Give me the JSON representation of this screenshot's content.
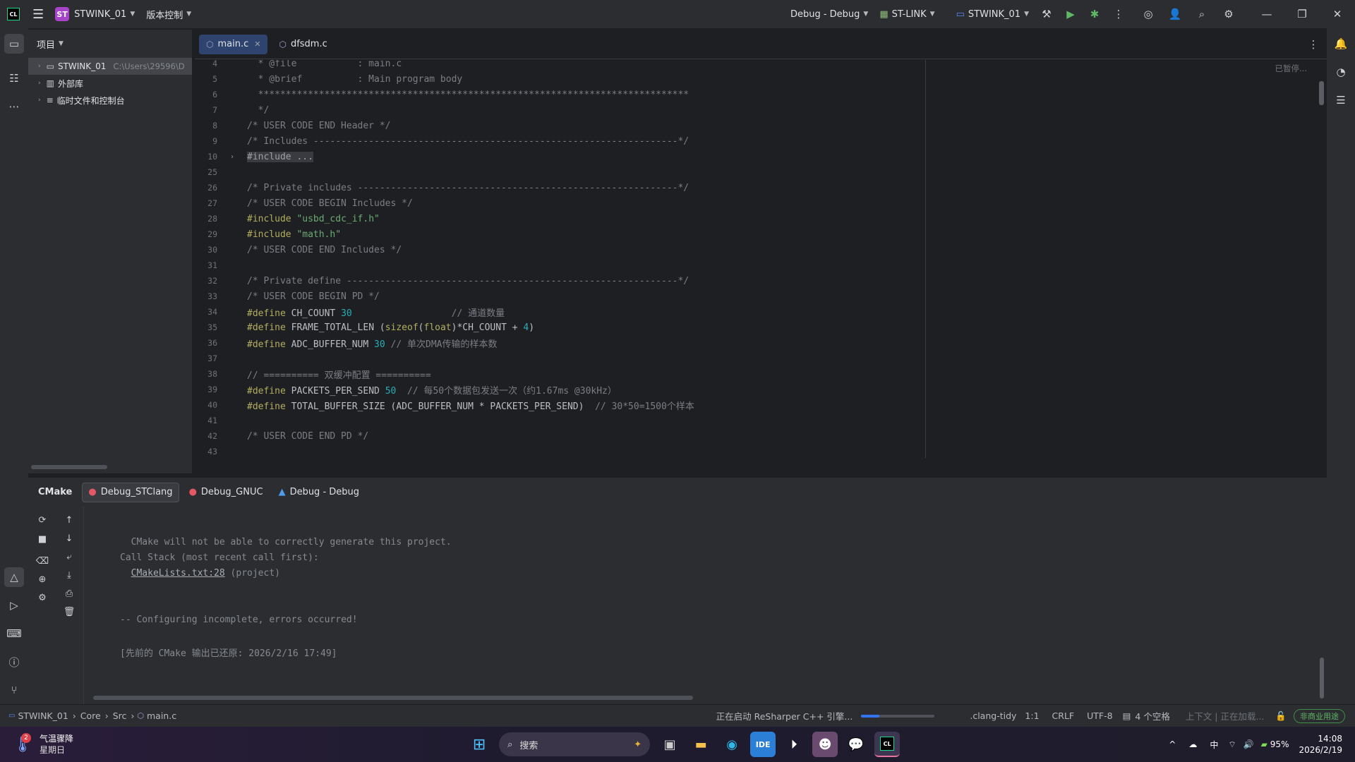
{
  "topbar": {
    "project_badge": "ST",
    "project_name": "STWINK_01",
    "vcs_label": "版本控制",
    "run_config": "Debug - Debug",
    "debugger": "ST-LINK",
    "target": "STWINK_01"
  },
  "project_panel": {
    "title": "项目",
    "items": [
      {
        "label": "STWINK_01",
        "path": "C:\\Users\\29596\\D"
      },
      {
        "label": "外部库",
        "path": ""
      },
      {
        "label": "临时文件和控制台",
        "path": ""
      }
    ]
  },
  "editor": {
    "tabs": [
      {
        "label": "main.c",
        "active": true
      },
      {
        "label": "dfsdm.c",
        "active": false
      }
    ],
    "paused_hint": "已暂停...",
    "lines": [
      {
        "n": "4",
        "text": "  * @file           : main.c"
      },
      {
        "n": "5",
        "text": "  * @brief          : Main program body"
      },
      {
        "n": "6",
        "text": "  ******************************************************************************"
      },
      {
        "n": "7",
        "text": "  */"
      },
      {
        "n": "8",
        "text": "/* USER CODE END Header */"
      },
      {
        "n": "9",
        "text": "/* Includes ------------------------------------------------------------------*/"
      },
      {
        "n": "10",
        "text": "#include ..."
      },
      {
        "n": "25",
        "text": ""
      },
      {
        "n": "26",
        "text": "/* Private includes ----------------------------------------------------------*/"
      },
      {
        "n": "27",
        "text": "/* USER CODE BEGIN Includes */"
      },
      {
        "n": "28",
        "text": "#include \"usbd_cdc_if.h\""
      },
      {
        "n": "29",
        "text": "#include \"math.h\""
      },
      {
        "n": "30",
        "text": "/* USER CODE END Includes */"
      },
      {
        "n": "31",
        "text": ""
      },
      {
        "n": "32",
        "text": "/* Private define ------------------------------------------------------------*/"
      },
      {
        "n": "33",
        "text": "/* USER CODE BEGIN PD */"
      },
      {
        "n": "34",
        "text": "#define CH_COUNT 30                  // 通道数量"
      },
      {
        "n": "35",
        "text": "#define FRAME_TOTAL_LEN (sizeof(float)*CH_COUNT + 4)"
      },
      {
        "n": "36",
        "text": "#define ADC_BUFFER_NUM 30 // 单次DMA传输的样本数"
      },
      {
        "n": "37",
        "text": ""
      },
      {
        "n": "38",
        "text": "// ========== 双缓冲配置 =========="
      },
      {
        "n": "39",
        "text": "#define PACKETS_PER_SEND 50  // 每50个数据包发送一次（约1.67ms @30kHz）"
      },
      {
        "n": "40",
        "text": "#define TOTAL_BUFFER_SIZE (ADC_BUFFER_NUM * PACKETS_PER_SEND)  // 30*50=1500个样本"
      },
      {
        "n": "41",
        "text": ""
      },
      {
        "n": "42",
        "text": "/* USER CODE END PD */"
      },
      {
        "n": "43",
        "text": ""
      }
    ]
  },
  "bottom_panel": {
    "title": "CMake",
    "tabs": [
      "Debug_STClang",
      "Debug_GNUC",
      "Debug - Debug"
    ],
    "output": [
      "  CMake will not be able to correctly generate this project.",
      "Call Stack (most recent call first):",
      "  CMakeLists.txt:28 (project)",
      "",
      "",
      "-- Configuring incomplete, errors occurred!",
      "",
      "[先前的 CMake 输出已还原: 2026/2/16 17:49]"
    ]
  },
  "statusbar": {
    "breadcrumb": [
      "STWINK_01",
      "Core",
      "Src",
      "main.c"
    ],
    "progress_text": "正在启动 ReSharper C++ 引擎...",
    "progress": 0.25,
    "items": [
      ".clang-tidy",
      "1:1",
      "CRLF",
      "UTF-8",
      "4 个空格",
      "上下文 | 正在加载..."
    ],
    "license": "非商业用途"
  },
  "taskbar": {
    "weather_badge": "2",
    "weather_title": "气温骤降",
    "weather_sub": "星期日",
    "search_placeholder": "搜索",
    "ime": "中",
    "battery": "95%",
    "time": "14:08",
    "date": "2026/2/19"
  },
  "colors": {
    "accent": "#3574f0",
    "tab_active": "#2e436e",
    "string": "#6aab73",
    "preprocessor": "#b3ae60",
    "comment": "#7a7e85"
  }
}
